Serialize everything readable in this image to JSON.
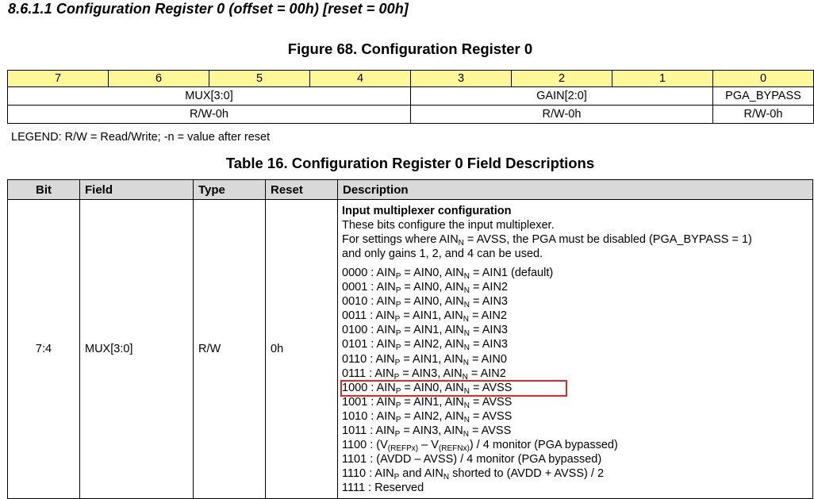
{
  "section_heading": "8.6.1.1   Configuration Register 0 (offset = 00h) [reset = 00h]",
  "figure_title": "Figure 68.  Configuration Register 0",
  "register": {
    "bits": [
      "7",
      "6",
      "5",
      "4",
      "3",
      "2",
      "1",
      "0"
    ],
    "fields": [
      "MUX[3:0]",
      "GAIN[2:0]",
      "PGA_BYPASS"
    ],
    "access": [
      "R/W-0h",
      "R/W-0h",
      "R/W-0h"
    ]
  },
  "legend": "LEGEND: R/W = Read/Write; -n = value after reset",
  "table_title": "Table 16. Configuration Register 0 Field Descriptions",
  "table": {
    "headers": {
      "bit": "Bit",
      "field": "Field",
      "type": "Type",
      "reset": "Reset",
      "description": "Description"
    },
    "row": {
      "bit": "7:4",
      "field": "MUX[3:0]",
      "type": "R/W",
      "reset": "0h",
      "desc_title": "Input multiplexer configuration",
      "desc_line1": "These bits configure the input multiplexer.",
      "desc_line2_a": "For settings where AIN",
      "desc_line2_sub": "N",
      "desc_line2_b": " = AVSS, the PGA must be disabled (PGA_BYPASS = 1)",
      "desc_line3": "and only gains 1, 2, and 4 can be used.",
      "options": [
        {
          "code": "0000",
          "p": "AIN0",
          "n": "AIN1 (default)"
        },
        {
          "code": "0001",
          "p": "AIN0",
          "n": "AIN2"
        },
        {
          "code": "0010",
          "p": "AIN0",
          "n": "AIN3"
        },
        {
          "code": "0011",
          "p": "AIN1",
          "n": "AIN2"
        },
        {
          "code": "0100",
          "p": "AIN1",
          "n": "AIN3"
        },
        {
          "code": "0101",
          "p": "AIN2",
          "n": "AIN3"
        },
        {
          "code": "0110",
          "p": "AIN1",
          "n": "AIN0"
        },
        {
          "code": "0111",
          "p": "AIN3",
          "n": "AIN2"
        },
        {
          "code": "1000",
          "p": "AIN0",
          "n": "AVSS",
          "highlighted": true
        },
        {
          "code": "1001",
          "p": "AIN1",
          "n": "AVSS"
        },
        {
          "code": "1010",
          "p": "AIN2",
          "n": "AVSS"
        },
        {
          "code": "1011",
          "p": "AIN3",
          "n": "AVSS"
        }
      ],
      "opt_1100": {
        "code": "1100",
        "v1": "V",
        "v1_sub": "(REFPx)",
        "dash": " – ",
        "v2": "V",
        "v2_sub": "(REFNx)",
        "rest": ") / 4 monitor (PGA bypassed)"
      },
      "opt_1101": "1101 : (AVDD – AVSS) / 4 monitor (PGA bypassed)",
      "opt_1110": {
        "code": "1110",
        "a": "AIN",
        "a_sub": "P",
        "b": " and AIN",
        "b_sub": "N",
        "rest": " shorted to (AVDD + AVSS) / 2"
      },
      "opt_1111": "1111 : Reserved"
    }
  },
  "highlight_color": "#e02a2a",
  "register_bits_bg": "#fff799",
  "table_header_bg": "#d9d9d9"
}
